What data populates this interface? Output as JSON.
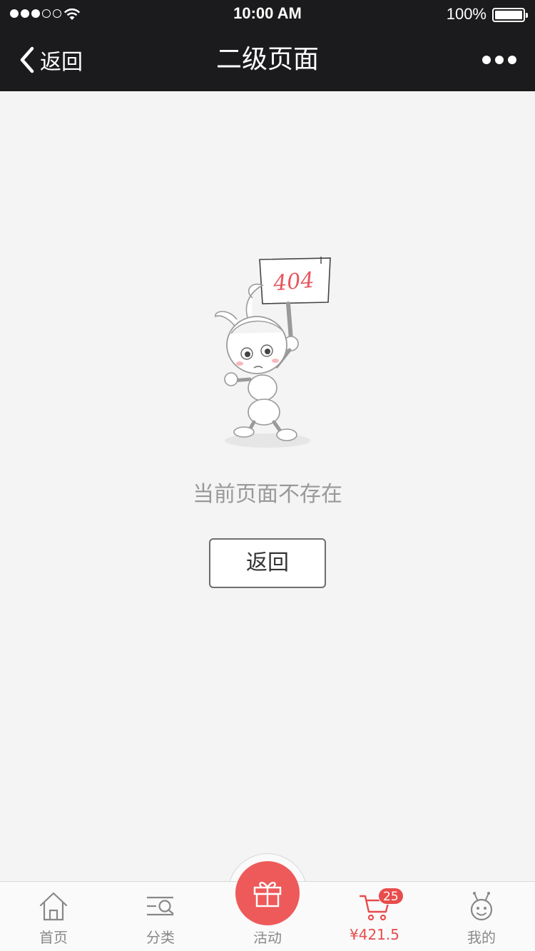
{
  "status_bar": {
    "time": "10:00 AM",
    "battery": "100%",
    "signal_bars_filled": 3,
    "signal_bars_total": 5
  },
  "nav": {
    "back_label": "返回",
    "title": "二级页面",
    "more_icon": "more-dots-icon"
  },
  "illustration": {
    "sign_text": "404",
    "icon": "ant-mascot-404-illustration"
  },
  "content": {
    "message": "当前页面不存在",
    "button_label": "返回"
  },
  "tabs": [
    {
      "label": "首页",
      "icon": "home-icon"
    },
    {
      "label": "分类",
      "icon": "category-search-icon"
    },
    {
      "label": "活动",
      "icon": "gift-icon"
    },
    {
      "label": "¥421.5",
      "icon": "cart-icon",
      "badge": "25"
    },
    {
      "label": "我的",
      "icon": "profile-icon"
    }
  ],
  "colors": {
    "bar_bg": "#1b1b1d",
    "page_bg": "#f4f4f4",
    "accent": "#ee5a5a",
    "muted_text": "#999999"
  }
}
